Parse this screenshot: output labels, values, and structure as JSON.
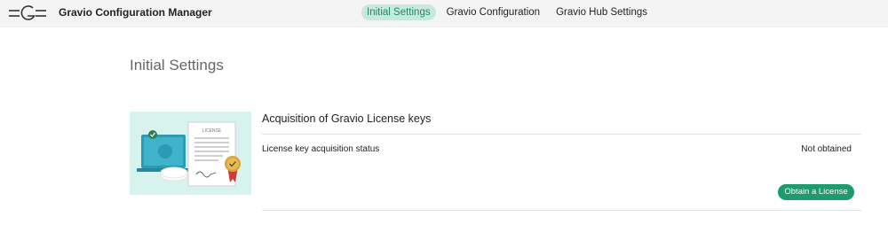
{
  "header": {
    "logo_icon": "gravio-logo-icon",
    "app_title": "Gravio Configuration Manager",
    "nav": [
      {
        "label": "Initial Settings",
        "active": true
      },
      {
        "label": "Gravio Configuration",
        "active": false
      },
      {
        "label": "Gravio Hub Settings",
        "active": false
      }
    ]
  },
  "main": {
    "page_title": "Initial Settings",
    "card": {
      "illustration_icon": "license-illustration-icon",
      "illustration_text": "LICENSE",
      "title": "Acquisition of Gravio License keys",
      "status_label": "License key acquisition status",
      "status_value": "Not obtained",
      "button_label": "Obtain a License"
    }
  },
  "colors": {
    "accent": "#1e9b6e",
    "nav_active_bg": "#c7e9dc",
    "illustration_bg": "#d8f3ee"
  }
}
